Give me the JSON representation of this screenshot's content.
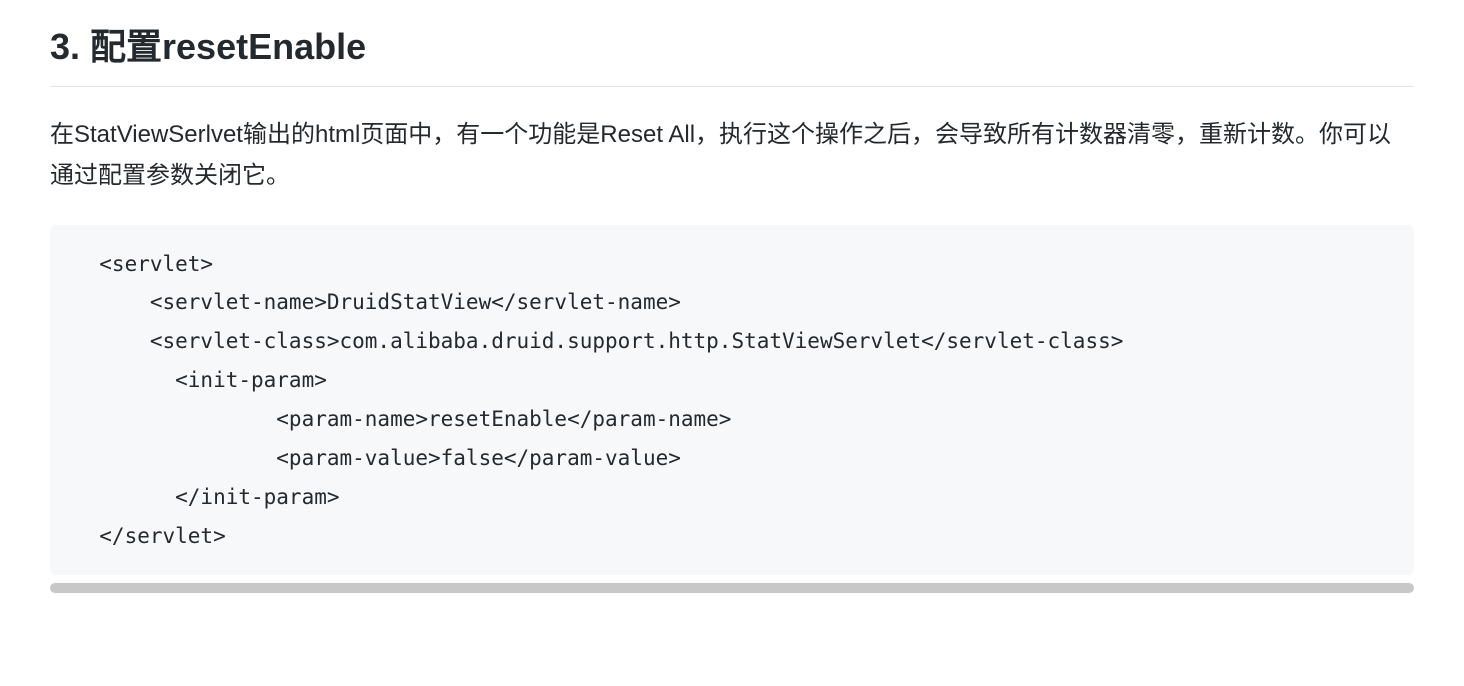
{
  "heading": "3. 配置resetEnable",
  "paragraph": "在StatViewSerlvet输出的html页面中，有一个功能是Reset All，执行这个操作之后，会导致所有计数器清零，重新计数。你可以通过配置参数关闭它。",
  "code": "  <servlet>\n      <servlet-name>DruidStatView</servlet-name>\n      <servlet-class>com.alibaba.druid.support.http.StatViewServlet</servlet-class>\n        <init-param>\n                <param-name>resetEnable</param-name>\n                <param-value>false</param-value>\n        </init-param>\n  </servlet>"
}
